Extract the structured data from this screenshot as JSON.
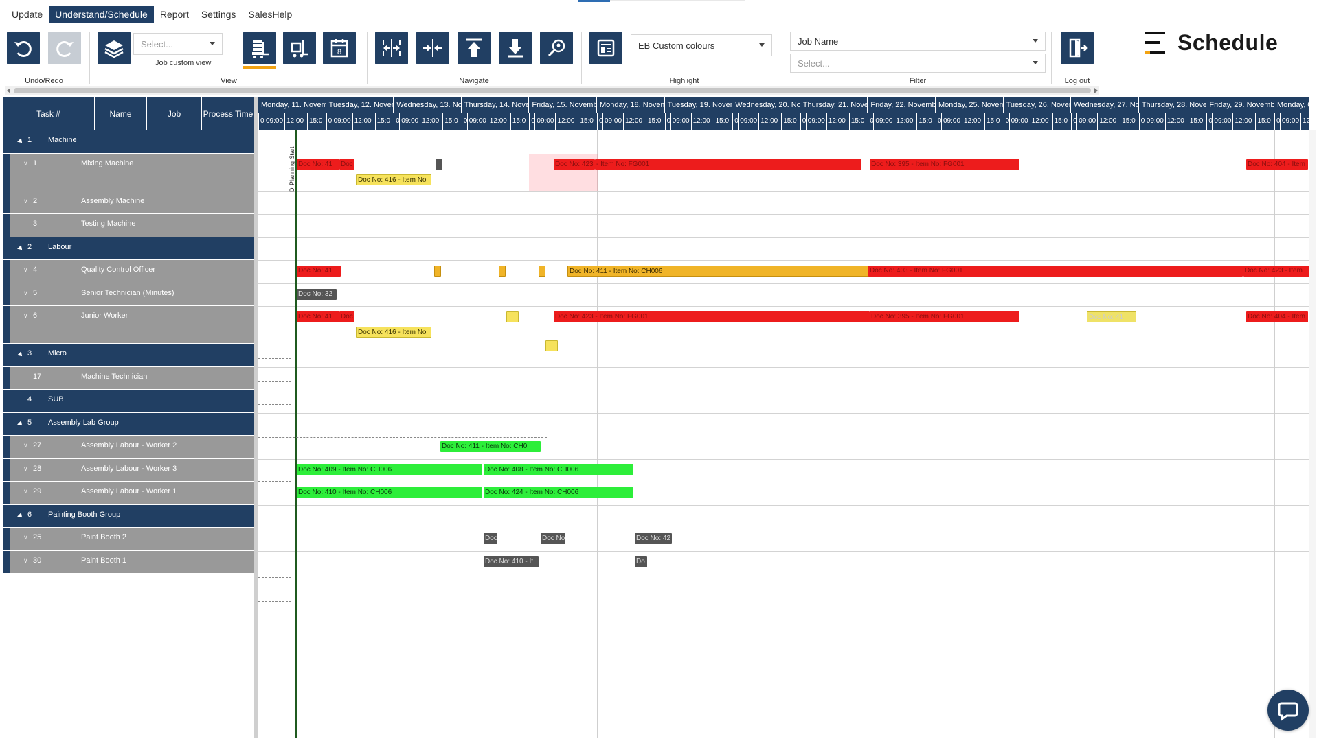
{
  "menu": [
    {
      "label": "Update",
      "active": false
    },
    {
      "label": "Understand/Schedule",
      "active": true
    },
    {
      "label": "Report",
      "active": false
    },
    {
      "label": "Settings",
      "active": false
    },
    {
      "label": "SalesHelp",
      "active": false
    }
  ],
  "ribbon": {
    "undo_redo_label": "Undo/Redo",
    "view_label": "View",
    "view_select_placeholder": "Select...",
    "job_custom_view": "Job custom view",
    "navigate_label": "Navigate",
    "highlight_label": "Highlight",
    "highlight_value": "EB Custom colours",
    "filter_label": "Filter",
    "filter_field": "Job Name",
    "filter_select_placeholder": "Select...",
    "logout_label": "Log out",
    "calendar_day": "8"
  },
  "brand": {
    "name": "Schedule"
  },
  "colors": {
    "primary": "#213f63",
    "accent": "#f2a313",
    "red": "#ed1c1c",
    "green": "#2dee3a",
    "orange": "#f0b428",
    "yellow": "#f6e25c"
  },
  "grid": {
    "headers": [
      "Task #",
      "Name",
      "Job",
      "Process Time"
    ],
    "rows": [
      {
        "type": "group",
        "num": "1",
        "name": "Machine"
      },
      {
        "type": "res",
        "num": "1",
        "name": "Mixing Machine",
        "tall": true
      },
      {
        "type": "res",
        "num": "2",
        "name": "Assembly Machine"
      },
      {
        "type": "res",
        "num": "3",
        "name": "Testing Machine",
        "nochev": true
      },
      {
        "type": "group",
        "num": "2",
        "name": "Labour"
      },
      {
        "type": "res",
        "num": "4",
        "name": "Quality Control Officer"
      },
      {
        "type": "res",
        "num": "5",
        "name": "Senior Technician (Minutes)"
      },
      {
        "type": "res",
        "num": "6",
        "name": "Junior Worker",
        "tall": true
      },
      {
        "type": "group",
        "num": "3",
        "name": "Micro"
      },
      {
        "type": "res",
        "num": "17",
        "name": "Machine Technician",
        "nochev": true
      },
      {
        "type": "group",
        "num": "4",
        "name": "SUB",
        "notri": true
      },
      {
        "type": "group",
        "num": "5",
        "name": "Assembly Lab Group"
      },
      {
        "type": "res",
        "num": "27",
        "name": "Assembly Labour - Worker 2"
      },
      {
        "type": "res",
        "num": "28",
        "name": "Assembly Labour - Worker 3"
      },
      {
        "type": "res",
        "num": "29",
        "name": "Assembly Labour - Worker 1"
      },
      {
        "type": "group",
        "num": "6",
        "name": "Painting Booth Group"
      },
      {
        "type": "res",
        "num": "25",
        "name": "Paint Booth 2"
      },
      {
        "type": "res",
        "num": "30",
        "name": "Paint Booth 1"
      }
    ]
  },
  "gantt": {
    "days": [
      "Monday, 11. Novem",
      "Tuesday, 12. Novem",
      "Wednesday, 13. Nov",
      "Thursday, 14. Novem",
      "Friday, 15. Novembe",
      "Monday, 18. Novem",
      "Tuesday, 19. Novem",
      "Wednesday, 20. Nov",
      "Thursday, 21. Novem",
      "Friday, 22. Novembe",
      "Monday, 25. Novem",
      "Tuesday, 26. Novem",
      "Wednesday, 27. Nov",
      "Thursday, 28. Novem",
      "Friday, 29. Novembe",
      "Monday, 02"
    ],
    "times": [
      "0",
      "09:00",
      "12:00",
      "15:0"
    ],
    "start_label": "Planning Start",
    "start_label_alt": "D",
    "bars": {
      "b1": "Doc No: 41",
      "b2": "Doc",
      "b3": "Doc No: 416 - Item No",
      "b4": "Doc No: 423",
      "b5": "- Item No: FG001",
      "b6": "Doc No: 395 - Item No: FG001",
      "b7": "Doc No: 404 - Item",
      "b8": "Doc No: 41",
      "b9": "Doc No: 411 - Item No: CH006",
      "b10": "Doc No: 403 - Item No: FG001",
      "b11": "Doc No: 423 - Item",
      "b12": "Doc No: 32",
      "b13": "Doc No: 41",
      "b14": "Doc",
      "b15": "Doc No: 423 - Item No: FG001",
      "b16": "Doc No: 395 - Item No: FG001",
      "b17": "Doc No: 41",
      "b18": "Doc No: 404 - Item",
      "b19": "Doc No: 416 - Item No",
      "b20": "Doc No: 411 - Item No: CH0",
      "b21": "Doc No: 409 - Item No: CH006",
      "b22": "Doc No: 408 - Item No: CH006",
      "b23": "Doc No: 410 - Item No: CH006",
      "b24": "Doc No: 424 - Item No: CH006",
      "b25": "Doc",
      "b26": "Doc No",
      "b27": "Doc No: 42",
      "b28": "Doc No: 410 - It",
      "b29": "Do"
    }
  }
}
